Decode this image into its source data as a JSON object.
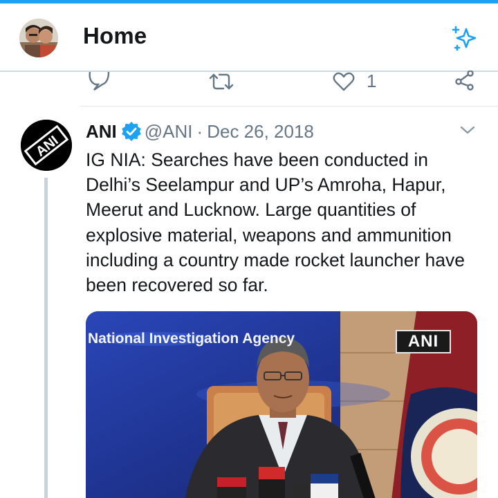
{
  "header": {
    "title": "Home"
  },
  "previous_tweet": {
    "like_count": "1"
  },
  "tweet": {
    "author_name": "ANI",
    "handle": "@ANI",
    "separator": "·",
    "date": "Dec 26, 2018",
    "text": "IG NIA: Searches have been conducted in Delhi’s Seelampur and UP’s Amroha, Hapur, Meerut and Lucknow. Large quantities of explosive material, weapons and ammunition including a country made rocket launcher have been recovered so far.",
    "media": {
      "banner_text": "National Investigation Agency",
      "watermark": "ANI"
    }
  },
  "colors": {
    "accent": "#1da1f2",
    "text_primary": "#14171a",
    "text_secondary": "#657786",
    "divider": "#e1e8ed"
  },
  "icons": {
    "header_right": "sparkle-icon",
    "actions": [
      "reply-icon",
      "retweet-icon",
      "like-icon",
      "share-icon"
    ],
    "verified": "verified-badge-icon",
    "caret": "chevron-down-icon"
  }
}
